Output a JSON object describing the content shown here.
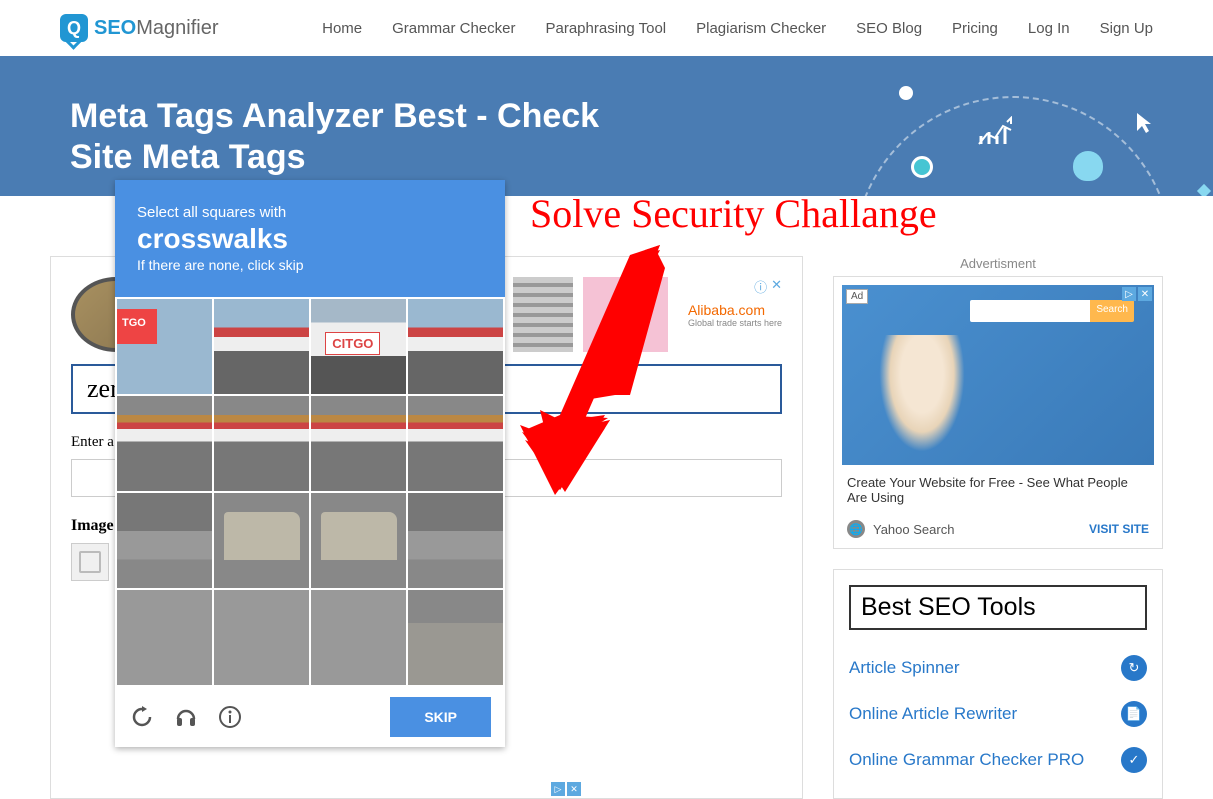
{
  "logo": {
    "brand1": "SEO",
    "brand2": "Magnifier",
    "iconLetter": "Q"
  },
  "nav": {
    "home": "Home",
    "grammar": "Grammar Checker",
    "paraphrase": "Paraphrasing Tool",
    "plagiarism": "Plagiarism Checker",
    "blog": "SEO Blog",
    "pricing": "Pricing",
    "login": "Log In",
    "signup": "Sign Up"
  },
  "hero": {
    "title": "Meta Tags Analyzer Best - Check Site Meta Tags"
  },
  "annotation": {
    "text": "Solve Security Challange"
  },
  "captcha": {
    "line1": "Select all squares with",
    "target": "crosswalks",
    "line3": "If there are none, click skip",
    "skip": "SKIP",
    "citgo_full": "CITGO",
    "citgo_partial": "TGO"
  },
  "main": {
    "toolTitle": "zer",
    "enterUrl": "Enter a URL",
    "verifyLabel": "Image Verification"
  },
  "inlineAd": {
    "brand": "Alibaba.com",
    "tagline": "Global trade starts here"
  },
  "sidebar": {
    "adLabel": "Advertisment",
    "adBadge": "Ad",
    "adSearch": "Search",
    "adText": "Create Your Website for Free - See What People Are Using",
    "adSource": "Yahoo Search",
    "adVisit": "VISIT SITE",
    "toolsTitle": "Best SEO Tools",
    "tools": {
      "spinner": "Article Spinner",
      "rewriter": "Online Article Rewriter",
      "grammar": "Online Grammar Checker PRO"
    }
  }
}
